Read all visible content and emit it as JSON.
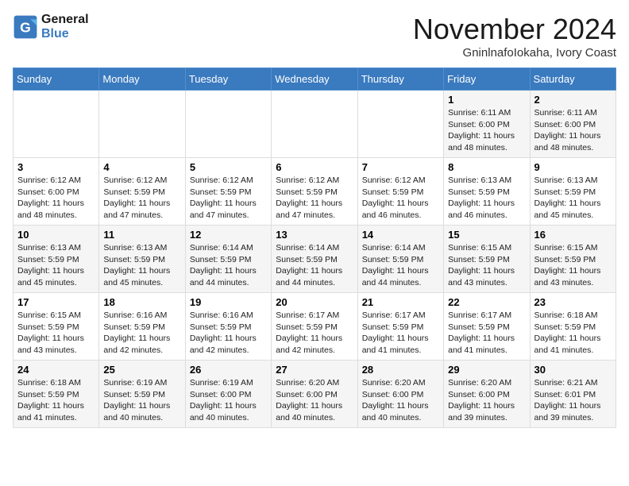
{
  "logo": {
    "line1": "General",
    "line2": "Blue"
  },
  "title": "November 2024",
  "location": "GninlnafoIokaha, Ivory Coast",
  "weekdays": [
    "Sunday",
    "Monday",
    "Tuesday",
    "Wednesday",
    "Thursday",
    "Friday",
    "Saturday"
  ],
  "weeks": [
    [
      {
        "day": "",
        "info": ""
      },
      {
        "day": "",
        "info": ""
      },
      {
        "day": "",
        "info": ""
      },
      {
        "day": "",
        "info": ""
      },
      {
        "day": "",
        "info": ""
      },
      {
        "day": "1",
        "info": "Sunrise: 6:11 AM\nSunset: 6:00 PM\nDaylight: 11 hours\nand 48 minutes."
      },
      {
        "day": "2",
        "info": "Sunrise: 6:11 AM\nSunset: 6:00 PM\nDaylight: 11 hours\nand 48 minutes."
      }
    ],
    [
      {
        "day": "3",
        "info": "Sunrise: 6:12 AM\nSunset: 6:00 PM\nDaylight: 11 hours\nand 48 minutes."
      },
      {
        "day": "4",
        "info": "Sunrise: 6:12 AM\nSunset: 5:59 PM\nDaylight: 11 hours\nand 47 minutes."
      },
      {
        "day": "5",
        "info": "Sunrise: 6:12 AM\nSunset: 5:59 PM\nDaylight: 11 hours\nand 47 minutes."
      },
      {
        "day": "6",
        "info": "Sunrise: 6:12 AM\nSunset: 5:59 PM\nDaylight: 11 hours\nand 47 minutes."
      },
      {
        "day": "7",
        "info": "Sunrise: 6:12 AM\nSunset: 5:59 PM\nDaylight: 11 hours\nand 46 minutes."
      },
      {
        "day": "8",
        "info": "Sunrise: 6:13 AM\nSunset: 5:59 PM\nDaylight: 11 hours\nand 46 minutes."
      },
      {
        "day": "9",
        "info": "Sunrise: 6:13 AM\nSunset: 5:59 PM\nDaylight: 11 hours\nand 45 minutes."
      }
    ],
    [
      {
        "day": "10",
        "info": "Sunrise: 6:13 AM\nSunset: 5:59 PM\nDaylight: 11 hours\nand 45 minutes."
      },
      {
        "day": "11",
        "info": "Sunrise: 6:13 AM\nSunset: 5:59 PM\nDaylight: 11 hours\nand 45 minutes."
      },
      {
        "day": "12",
        "info": "Sunrise: 6:14 AM\nSunset: 5:59 PM\nDaylight: 11 hours\nand 44 minutes."
      },
      {
        "day": "13",
        "info": "Sunrise: 6:14 AM\nSunset: 5:59 PM\nDaylight: 11 hours\nand 44 minutes."
      },
      {
        "day": "14",
        "info": "Sunrise: 6:14 AM\nSunset: 5:59 PM\nDaylight: 11 hours\nand 44 minutes."
      },
      {
        "day": "15",
        "info": "Sunrise: 6:15 AM\nSunset: 5:59 PM\nDaylight: 11 hours\nand 43 minutes."
      },
      {
        "day": "16",
        "info": "Sunrise: 6:15 AM\nSunset: 5:59 PM\nDaylight: 11 hours\nand 43 minutes."
      }
    ],
    [
      {
        "day": "17",
        "info": "Sunrise: 6:15 AM\nSunset: 5:59 PM\nDaylight: 11 hours\nand 43 minutes."
      },
      {
        "day": "18",
        "info": "Sunrise: 6:16 AM\nSunset: 5:59 PM\nDaylight: 11 hours\nand 42 minutes."
      },
      {
        "day": "19",
        "info": "Sunrise: 6:16 AM\nSunset: 5:59 PM\nDaylight: 11 hours\nand 42 minutes."
      },
      {
        "day": "20",
        "info": "Sunrise: 6:17 AM\nSunset: 5:59 PM\nDaylight: 11 hours\nand 42 minutes."
      },
      {
        "day": "21",
        "info": "Sunrise: 6:17 AM\nSunset: 5:59 PM\nDaylight: 11 hours\nand 41 minutes."
      },
      {
        "day": "22",
        "info": "Sunrise: 6:17 AM\nSunset: 5:59 PM\nDaylight: 11 hours\nand 41 minutes."
      },
      {
        "day": "23",
        "info": "Sunrise: 6:18 AM\nSunset: 5:59 PM\nDaylight: 11 hours\nand 41 minutes."
      }
    ],
    [
      {
        "day": "24",
        "info": "Sunrise: 6:18 AM\nSunset: 5:59 PM\nDaylight: 11 hours\nand 41 minutes."
      },
      {
        "day": "25",
        "info": "Sunrise: 6:19 AM\nSunset: 5:59 PM\nDaylight: 11 hours\nand 40 minutes."
      },
      {
        "day": "26",
        "info": "Sunrise: 6:19 AM\nSunset: 6:00 PM\nDaylight: 11 hours\nand 40 minutes."
      },
      {
        "day": "27",
        "info": "Sunrise: 6:20 AM\nSunset: 6:00 PM\nDaylight: 11 hours\nand 40 minutes."
      },
      {
        "day": "28",
        "info": "Sunrise: 6:20 AM\nSunset: 6:00 PM\nDaylight: 11 hours\nand 40 minutes."
      },
      {
        "day": "29",
        "info": "Sunrise: 6:20 AM\nSunset: 6:00 PM\nDaylight: 11 hours\nand 39 minutes."
      },
      {
        "day": "30",
        "info": "Sunrise: 6:21 AM\nSunset: 6:01 PM\nDaylight: 11 hours\nand 39 minutes."
      }
    ]
  ]
}
